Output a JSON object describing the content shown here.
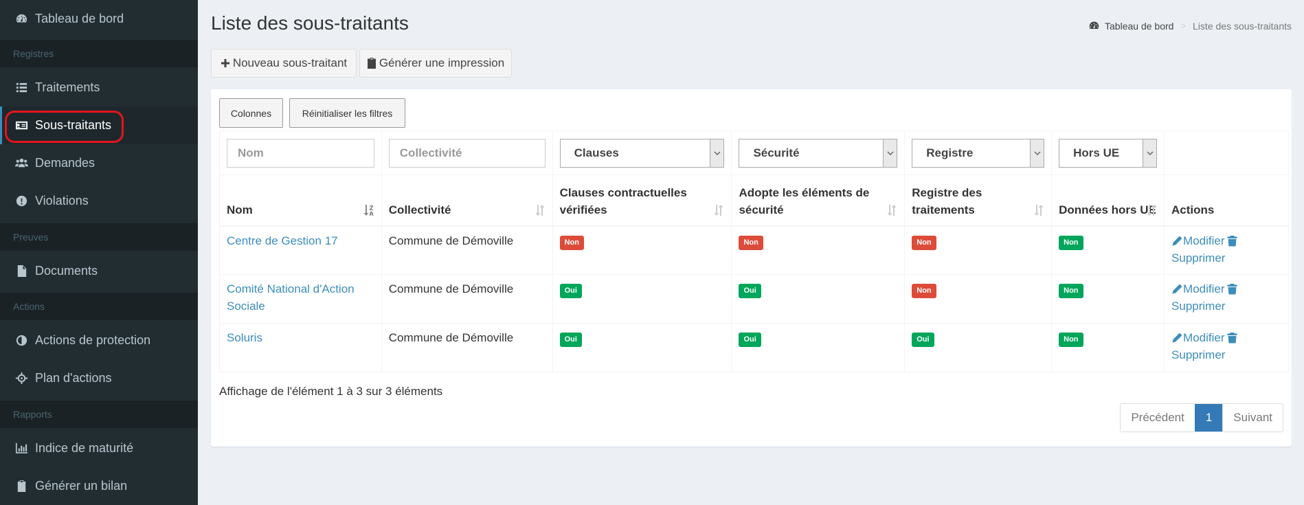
{
  "sidebar": {
    "dashboard": "Tableau de bord",
    "section_registres": "Registres",
    "traitements": "Traitements",
    "sous_traitants": "Sous-traitants",
    "demandes": "Demandes",
    "violations": "Violations",
    "section_preuves": "Preuves",
    "documents": "Documents",
    "section_actions": "Actions",
    "actions_protection": "Actions de protection",
    "plan_actions": "Plan d'actions",
    "section_rapports": "Rapports",
    "indice_maturite": "Indice de maturité",
    "generer_bilan": "Générer un bilan"
  },
  "page": {
    "title": "Liste des sous-traitants",
    "breadcrumb_home": "Tableau de bord",
    "breadcrumb_sep": ">",
    "breadcrumb_current": "Liste des sous-traitants"
  },
  "toolbar": {
    "new_label": "Nouveau sous-traitant",
    "print_label": "Générer une impression"
  },
  "table_tools": {
    "columns_label": "Colonnes",
    "reset_label": "Réinitialiser les filtres"
  },
  "filters": {
    "nom_placeholder": "Nom",
    "collectivite_placeholder": "Collectivité",
    "clauses_value": "Clauses",
    "securite_value": "Sécurité",
    "registre_value": "Registre",
    "hors_ue_value": "Hors UE"
  },
  "columns": {
    "nom": "Nom",
    "collectivite": "Collectivité",
    "clauses": "Clauses contractuelles vérifiées",
    "securite": "Adopte les éléments de sécurité",
    "registre": "Registre des traitements",
    "hors_ue": "Données hors UE",
    "actions": "Actions"
  },
  "rows": [
    {
      "nom": "Centre de Gestion 17",
      "collectivite": "Commune de Démoville",
      "clauses": "Non",
      "securite": "Non",
      "registre": "Non",
      "hors_ue": "Non",
      "modifier": "Modifier",
      "supprimer": "Supprimer"
    },
    {
      "nom": "Comité National d'Action Sociale",
      "collectivite": "Commune de Démoville",
      "clauses": "Oui",
      "securite": "Oui",
      "registre": "Non",
      "hors_ue": "Non",
      "modifier": "Modifier",
      "supprimer": "Supprimer"
    },
    {
      "nom": "Soluris",
      "collectivite": "Commune de Démoville",
      "clauses": "Oui",
      "securite": "Oui",
      "registre": "Oui",
      "hors_ue": "Non",
      "modifier": "Modifier",
      "supprimer": "Supprimer"
    }
  ],
  "footer": {
    "info": "Affichage de l'élément 1 à 3 sur 3 éléments",
    "prev": "Précédent",
    "current_page": "1",
    "next": "Suivant"
  },
  "colors": {
    "sidebar_bg": "#222d32",
    "accent": "#3c8dbc",
    "badge_red": "#dd4b39",
    "badge_green": "#00a65a",
    "highlight": "#e3151c"
  }
}
